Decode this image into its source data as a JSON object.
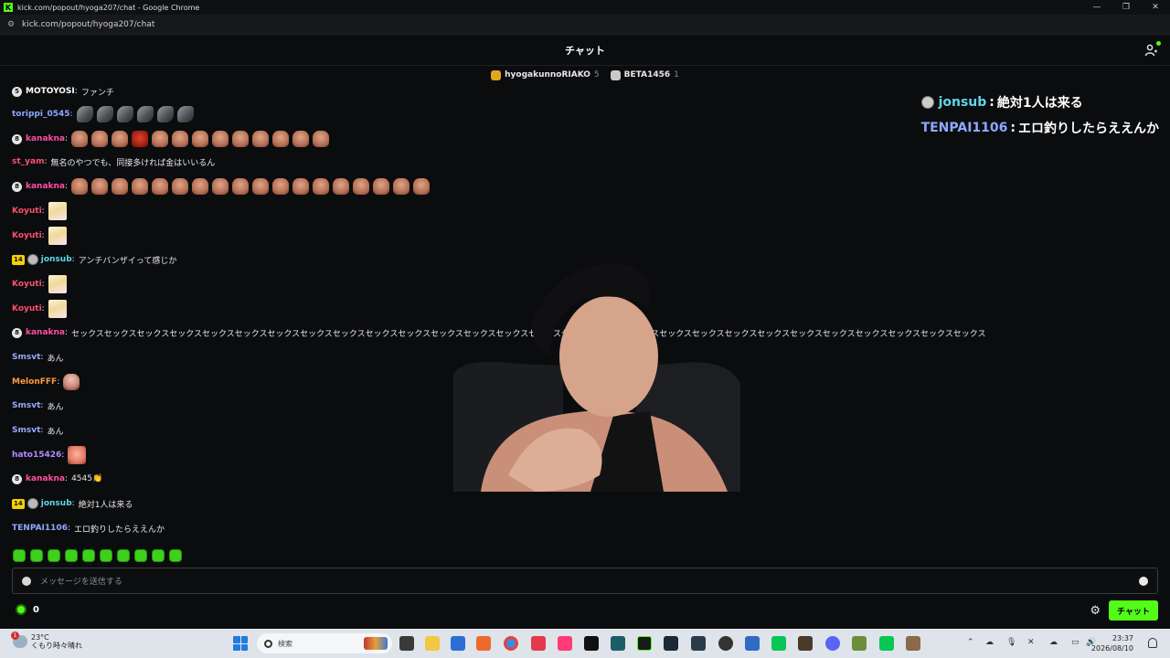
{
  "window": {
    "title": "kick.com/popout/hyoga207/chat - Google Chrome",
    "url": "kick.com/popout/hyoga207/chat"
  },
  "header": {
    "title": "チャット"
  },
  "gifters": [
    {
      "name": "hyogakunnoRIAKO",
      "count": "5",
      "color": "#e0a81c"
    },
    {
      "name": "BETA1456",
      "count": "1",
      "color": "#c9c9c9"
    }
  ],
  "messages": [
    {
      "badge": "5",
      "user": "MOTOYOSI",
      "user_color": "#ffffff",
      "text": "ファンチ"
    },
    {
      "user": "torippi_0545",
      "user_color": "#8fa8ff",
      "emotes": [
        "bullet",
        "bullet",
        "bullet",
        "bullet",
        "bullet",
        "bullet"
      ]
    },
    {
      "badge": "8",
      "user": "kanakna",
      "user_color": "#ff4fa0",
      "emotes": [
        "face",
        "face",
        "face",
        "redface",
        "face",
        "face",
        "face",
        "face",
        "face",
        "face",
        "face",
        "face",
        "face"
      ]
    },
    {
      "user": "st_yam",
      "user_color": "#ff4f6e",
      "text": "無名のやつでも、同接多ければ金はいいるん"
    },
    {
      "badge": "8",
      "user": "kanakna",
      "user_color": "#ff4fa0",
      "emotes": [
        "face",
        "face",
        "face",
        "face",
        "face",
        "face",
        "face",
        "face",
        "face",
        "face",
        "face",
        "face",
        "face",
        "face",
        "face",
        "face",
        "face",
        "face"
      ]
    },
    {
      "user": "Koyuti",
      "user_color": "#ff4f6e",
      "emotes": [
        "anime"
      ]
    },
    {
      "user": "Koyuti",
      "user_color": "#ff4f6e",
      "emotes": [
        "anime"
      ]
    },
    {
      "badge_num": "14",
      "avatar": true,
      "user": "jonsub",
      "user_color": "#5fd6e8",
      "text": "アンチバンザイって感じか"
    },
    {
      "user": "Koyuti",
      "user_color": "#ff4f6e",
      "emotes": [
        "anime"
      ]
    },
    {
      "user": "Koyuti",
      "user_color": "#ff4f6e",
      "emotes": [
        "anime"
      ]
    },
    {
      "badge": "8",
      "user": "kanakna",
      "user_color": "#ff4fa0",
      "text": "セックスセックスセックスセックスセックスセックスセックスセックスセックスセックスセックスセックスセックスセックスセックスセックスセックスセックスセックスセックスセックスセックスセックスセックスセックスセックスセックスセックス"
    },
    {
      "user": "Smsvt",
      "user_color": "#9aa8ff",
      "text": "あん"
    },
    {
      "user": "MelonFFF",
      "user_color": "#ff9a3c",
      "emotes": [
        "bald"
      ]
    },
    {
      "user": "Smsvt",
      "user_color": "#9aa8ff",
      "text": "あん"
    },
    {
      "user": "Smsvt",
      "user_color": "#9aa8ff",
      "text": "あん"
    },
    {
      "user": "hato15426",
      "user_color": "#b28bff",
      "emotes": [
        "pinkface"
      ]
    },
    {
      "badge": "8",
      "user": "kanakna",
      "user_color": "#ff4fa0",
      "text": "4545👏"
    },
    {
      "badge_num": "14",
      "avatar": true,
      "user": "jonsub",
      "user_color": "#5fd6e8",
      "text": "絶対1人は来る"
    },
    {
      "user": "TENPAI1106",
      "user_color": "#8fa8ff",
      "text": "エロ釣りしたらええんか"
    }
  ],
  "overlay": [
    {
      "user": "jonsub",
      "user_color": "#5fd6e8",
      "text": "絶対1人は来る",
      "avatar": true
    },
    {
      "user": "TENPAI1106",
      "user_color": "#8fa8ff",
      "text": "エロ釣りしたらええんか",
      "avatar": false
    }
  ],
  "composer": {
    "placeholder": "メッセージを送信する"
  },
  "footer": {
    "points": "0",
    "chat_button": "チャット"
  },
  "taskbar": {
    "weather_temp": "23°C",
    "weather_desc": "くもり時々晴れ",
    "weather_alert": "1",
    "search_placeholder": "検索",
    "time": "23:37",
    "date": "2026/08/10"
  }
}
